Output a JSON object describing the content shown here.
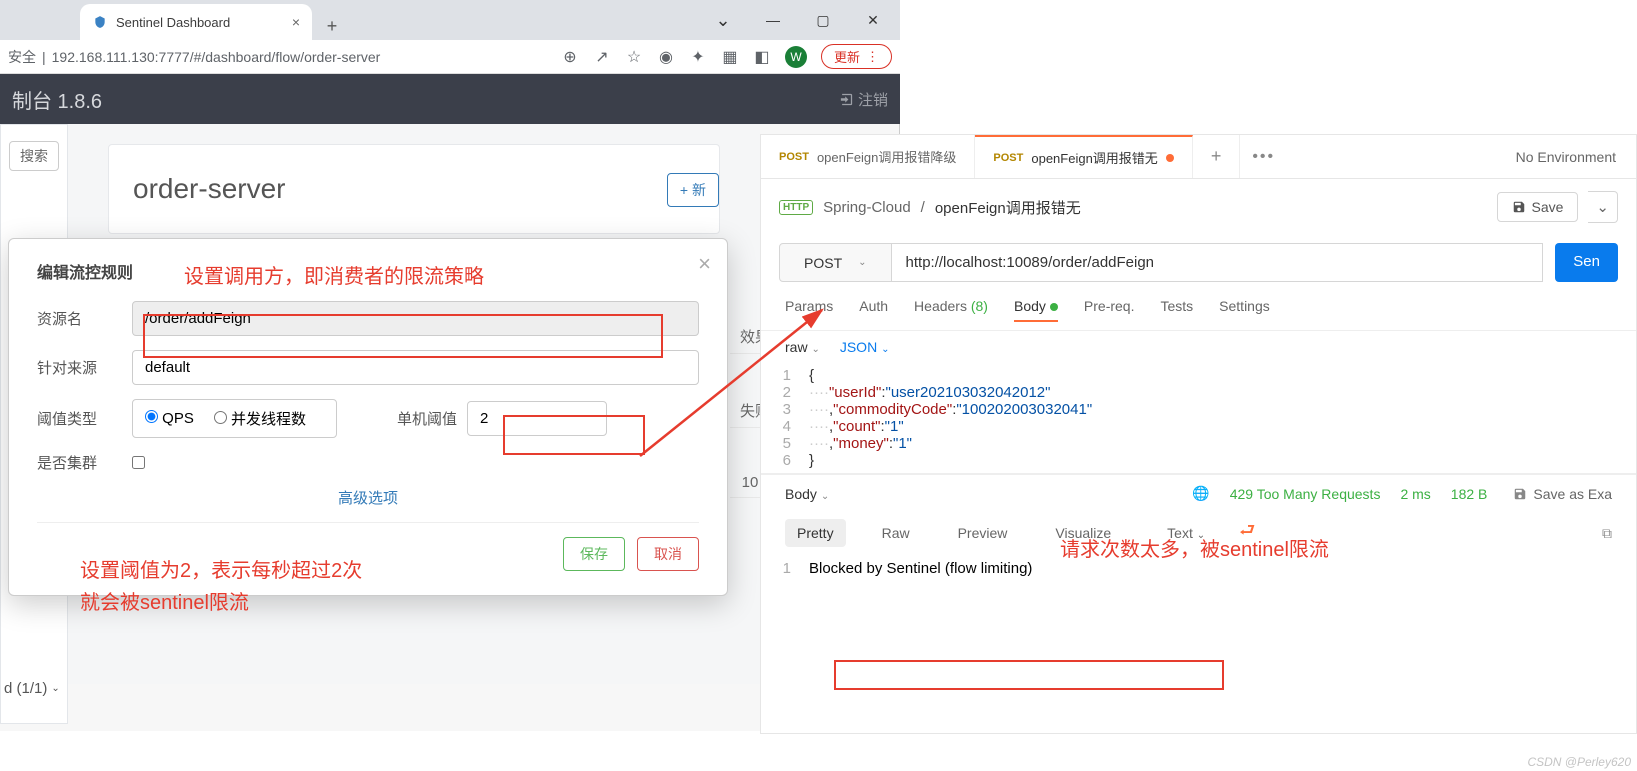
{
  "browser": {
    "tab_title": "Sentinel Dashboard",
    "url": "192.168.111.130:7777/#/dashboard/flow/order-server",
    "security_label": "安全",
    "update_btn": "更新"
  },
  "sentinel": {
    "brand": "制台 1.8.6",
    "logout": "注销",
    "search": "搜索",
    "pager": "d (1/1)",
    "page_title": "order-server",
    "add_btn": "+ 新",
    "row_eff": "效果",
    "row_fail": "失败",
    "row_10": "10"
  },
  "modal": {
    "title": "编辑流控规则",
    "label_resource": "资源名",
    "resource": "/order/addFeign",
    "label_origin": "针对来源",
    "origin": "default",
    "label_type": "阈值类型",
    "radio_qps": "QPS",
    "radio_thread": "并发线程数",
    "label_threshold": "单机阈值",
    "threshold": "2",
    "label_cluster": "是否集群",
    "advanced": "高级选项",
    "save": "保存",
    "cancel": "取消"
  },
  "notes": {
    "note1": "设置调用方，即消费者的限流策略",
    "note2_l1": "设置阈值为2，表示每秒超过2次",
    "note2_l2": "就会被sentinel限流",
    "note3": "请求次数太多，被sentinel限流"
  },
  "postman": {
    "tab1_method": "POST",
    "tab1_name": "openFeign调用报错降级",
    "tab2_method": "POST",
    "tab2_name": "openFeign调用报错无",
    "env": "No Environment",
    "bc_collection": "Spring-Cloud",
    "bc_name": "openFeign调用报错无",
    "save": "Save",
    "method": "POST",
    "url": "http://localhost:10089/order/addFeign",
    "send": "Sen",
    "reqtabs": {
      "params": "Params",
      "auth": "Auth",
      "headers": "Headers",
      "headers_n": "(8)",
      "body": "Body",
      "prereq": "Pre-req.",
      "tests": "Tests",
      "settings": "Settings"
    },
    "subtype_raw": "raw",
    "subtype_json": "JSON",
    "req_body": [
      "{",
      "    \"userId\":\"user202103032042012\"",
      "    ,\"commodityCode\":\"100202003032041\"",
      "    ,\"count\":\"1\"",
      "    ,\"money\":\"1\"",
      "}"
    ],
    "resp_label": "Body",
    "status": "429 Too Many Requests",
    "time": "2 ms",
    "size": "182 B",
    "save_example": "Save as Exa",
    "resptabs": {
      "pretty": "Pretty",
      "raw": "Raw",
      "preview": "Preview",
      "visualize": "Visualize",
      "text": "Text"
    },
    "resp_body": "Blocked by Sentinel (flow limiting)"
  },
  "watermark": "CSDN @Perley620"
}
